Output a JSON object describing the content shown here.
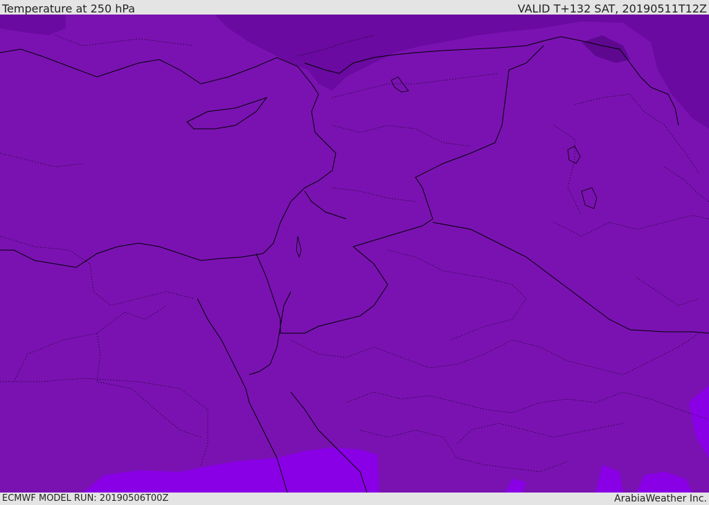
{
  "header": {
    "title": "Temperature at 250 hPa",
    "valid": "VALID T+132 SAT, 20190511T12Z"
  },
  "footer": {
    "model_run": "ECMWF MODEL RUN: 20190506T00Z",
    "credit": "ArabiaWeather Inc."
  },
  "map": {
    "colors": {
      "base_fill": "#7a12b2",
      "colder_fill": "#6a0aa0",
      "warmer_fill": "#8a00e6",
      "land_lines": "#000000"
    }
  }
}
